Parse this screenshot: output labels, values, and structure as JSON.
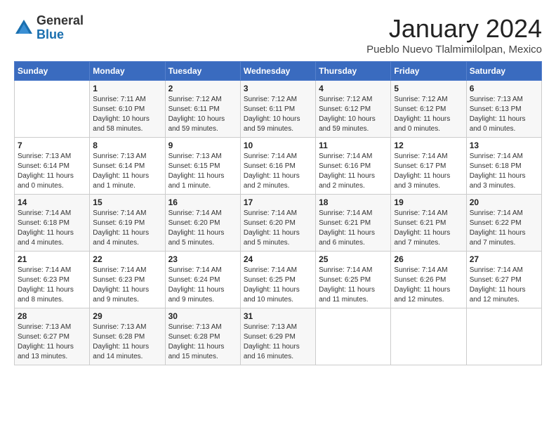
{
  "header": {
    "logo_general": "General",
    "logo_blue": "Blue",
    "month_title": "January 2024",
    "subtitle": "Pueblo Nuevo Tlalmimilolpan, Mexico"
  },
  "weekdays": [
    "Sunday",
    "Monday",
    "Tuesday",
    "Wednesday",
    "Thursday",
    "Friday",
    "Saturday"
  ],
  "weeks": [
    [
      {
        "day": "",
        "info": ""
      },
      {
        "day": "1",
        "info": "Sunrise: 7:11 AM\nSunset: 6:10 PM\nDaylight: 10 hours\nand 58 minutes."
      },
      {
        "day": "2",
        "info": "Sunrise: 7:12 AM\nSunset: 6:11 PM\nDaylight: 10 hours\nand 59 minutes."
      },
      {
        "day": "3",
        "info": "Sunrise: 7:12 AM\nSunset: 6:11 PM\nDaylight: 10 hours\nand 59 minutes."
      },
      {
        "day": "4",
        "info": "Sunrise: 7:12 AM\nSunset: 6:12 PM\nDaylight: 10 hours\nand 59 minutes."
      },
      {
        "day": "5",
        "info": "Sunrise: 7:12 AM\nSunset: 6:12 PM\nDaylight: 11 hours\nand 0 minutes."
      },
      {
        "day": "6",
        "info": "Sunrise: 7:13 AM\nSunset: 6:13 PM\nDaylight: 11 hours\nand 0 minutes."
      }
    ],
    [
      {
        "day": "7",
        "info": "Sunrise: 7:13 AM\nSunset: 6:14 PM\nDaylight: 11 hours\nand 0 minutes."
      },
      {
        "day": "8",
        "info": "Sunrise: 7:13 AM\nSunset: 6:14 PM\nDaylight: 11 hours\nand 1 minute."
      },
      {
        "day": "9",
        "info": "Sunrise: 7:13 AM\nSunset: 6:15 PM\nDaylight: 11 hours\nand 1 minute."
      },
      {
        "day": "10",
        "info": "Sunrise: 7:14 AM\nSunset: 6:16 PM\nDaylight: 11 hours\nand 2 minutes."
      },
      {
        "day": "11",
        "info": "Sunrise: 7:14 AM\nSunset: 6:16 PM\nDaylight: 11 hours\nand 2 minutes."
      },
      {
        "day": "12",
        "info": "Sunrise: 7:14 AM\nSunset: 6:17 PM\nDaylight: 11 hours\nand 3 minutes."
      },
      {
        "day": "13",
        "info": "Sunrise: 7:14 AM\nSunset: 6:18 PM\nDaylight: 11 hours\nand 3 minutes."
      }
    ],
    [
      {
        "day": "14",
        "info": "Sunrise: 7:14 AM\nSunset: 6:18 PM\nDaylight: 11 hours\nand 4 minutes."
      },
      {
        "day": "15",
        "info": "Sunrise: 7:14 AM\nSunset: 6:19 PM\nDaylight: 11 hours\nand 4 minutes."
      },
      {
        "day": "16",
        "info": "Sunrise: 7:14 AM\nSunset: 6:20 PM\nDaylight: 11 hours\nand 5 minutes."
      },
      {
        "day": "17",
        "info": "Sunrise: 7:14 AM\nSunset: 6:20 PM\nDaylight: 11 hours\nand 5 minutes."
      },
      {
        "day": "18",
        "info": "Sunrise: 7:14 AM\nSunset: 6:21 PM\nDaylight: 11 hours\nand 6 minutes."
      },
      {
        "day": "19",
        "info": "Sunrise: 7:14 AM\nSunset: 6:21 PM\nDaylight: 11 hours\nand 7 minutes."
      },
      {
        "day": "20",
        "info": "Sunrise: 7:14 AM\nSunset: 6:22 PM\nDaylight: 11 hours\nand 7 minutes."
      }
    ],
    [
      {
        "day": "21",
        "info": "Sunrise: 7:14 AM\nSunset: 6:23 PM\nDaylight: 11 hours\nand 8 minutes."
      },
      {
        "day": "22",
        "info": "Sunrise: 7:14 AM\nSunset: 6:23 PM\nDaylight: 11 hours\nand 9 minutes."
      },
      {
        "day": "23",
        "info": "Sunrise: 7:14 AM\nSunset: 6:24 PM\nDaylight: 11 hours\nand 9 minutes."
      },
      {
        "day": "24",
        "info": "Sunrise: 7:14 AM\nSunset: 6:25 PM\nDaylight: 11 hours\nand 10 minutes."
      },
      {
        "day": "25",
        "info": "Sunrise: 7:14 AM\nSunset: 6:25 PM\nDaylight: 11 hours\nand 11 minutes."
      },
      {
        "day": "26",
        "info": "Sunrise: 7:14 AM\nSunset: 6:26 PM\nDaylight: 11 hours\nand 12 minutes."
      },
      {
        "day": "27",
        "info": "Sunrise: 7:14 AM\nSunset: 6:27 PM\nDaylight: 11 hours\nand 12 minutes."
      }
    ],
    [
      {
        "day": "28",
        "info": "Sunrise: 7:13 AM\nSunset: 6:27 PM\nDaylight: 11 hours\nand 13 minutes."
      },
      {
        "day": "29",
        "info": "Sunrise: 7:13 AM\nSunset: 6:28 PM\nDaylight: 11 hours\nand 14 minutes."
      },
      {
        "day": "30",
        "info": "Sunrise: 7:13 AM\nSunset: 6:28 PM\nDaylight: 11 hours\nand 15 minutes."
      },
      {
        "day": "31",
        "info": "Sunrise: 7:13 AM\nSunset: 6:29 PM\nDaylight: 11 hours\nand 16 minutes."
      },
      {
        "day": "",
        "info": ""
      },
      {
        "day": "",
        "info": ""
      },
      {
        "day": "",
        "info": ""
      }
    ]
  ]
}
